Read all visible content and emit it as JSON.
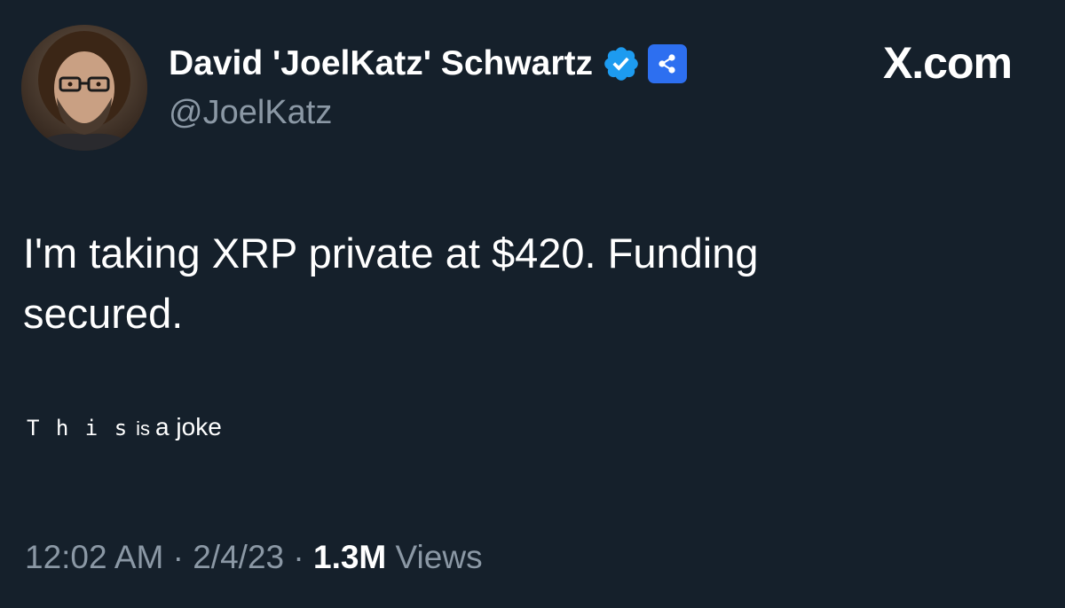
{
  "author": {
    "display_name": "David 'JoelKatz' Schwartz",
    "handle": "@JoelKatz",
    "verified_icon": "verified-check-icon",
    "affiliate_icon": "xrp-ledger-logo-icon",
    "colors": {
      "verified": "#1d9bf0",
      "affiliate_bg": "#2d6ff0"
    }
  },
  "brand": {
    "label": "X.com"
  },
  "tweet": {
    "text": "I'm taking XRP private at $420. Funding secured.",
    "joke_parts": {
      "spaced": "T h i s",
      "small": "is",
      "rest": "a joke"
    }
  },
  "meta": {
    "time": "12:02 AM",
    "separator": "·",
    "date": "2/4/23",
    "views_count": "1.3M",
    "views_label": "Views"
  },
  "colors": {
    "background": "#15202b",
    "secondary_text": "#8b98a5",
    "primary_text": "#ffffff"
  }
}
